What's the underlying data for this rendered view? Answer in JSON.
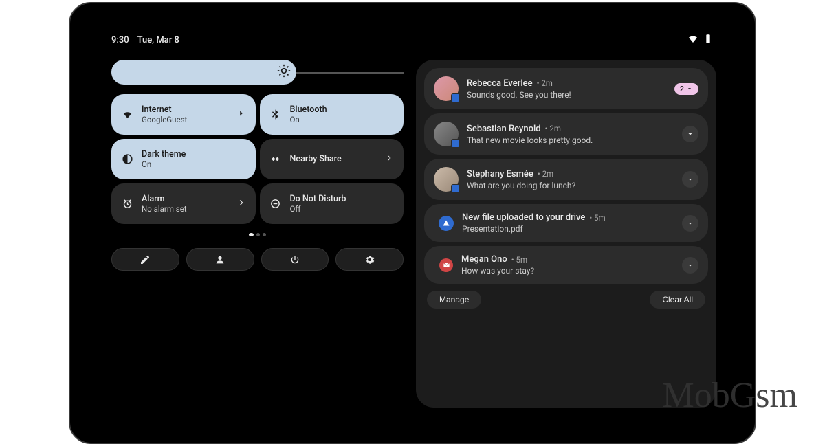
{
  "statusbar": {
    "time": "9:30",
    "date": "Tue, Mar 8"
  },
  "tiles": [
    {
      "title": "Internet",
      "sub": "GoogleGuest",
      "active": true,
      "chevron": true,
      "icon": "wifi"
    },
    {
      "title": "Bluetooth",
      "sub": "On",
      "active": true,
      "chevron": false,
      "icon": "bluetooth"
    },
    {
      "title": "Dark theme",
      "sub": "On",
      "active": true,
      "chevron": false,
      "icon": "contrast"
    },
    {
      "title": "Nearby Share",
      "sub": "",
      "active": false,
      "chevron": true,
      "icon": "nearby"
    },
    {
      "title": "Alarm",
      "sub": "No alarm set",
      "active": false,
      "chevron": true,
      "icon": "alarm"
    },
    {
      "title": "Do Not Disturb",
      "sub": "Off",
      "active": false,
      "chevron": false,
      "icon": "dnd"
    }
  ],
  "notifications": [
    {
      "name": "Rebecca Everlee",
      "time": "2m",
      "body": "Sounds good. See you there!",
      "badge": "2",
      "expand": false,
      "avatar": "a"
    },
    {
      "name": "Sebastian Reynold",
      "time": "2m",
      "body": "That new movie looks pretty good.",
      "expand": true,
      "avatar": "b"
    },
    {
      "name": "Stephany Esmée",
      "time": "2m",
      "body": "What are you doing for lunch?",
      "expand": true,
      "avatar": "c"
    },
    {
      "name": "New file uploaded to your drive",
      "time": "5m",
      "body": "Presentation.pdf",
      "expand": true,
      "avatar": "drive"
    },
    {
      "name": "Megan Ono",
      "time": "5m",
      "body": "How was your stay?",
      "expand": true,
      "avatar": "gmail"
    }
  ],
  "footer": {
    "manage": "Manage",
    "clear": "Clear All"
  },
  "watermark": "MobGsm"
}
